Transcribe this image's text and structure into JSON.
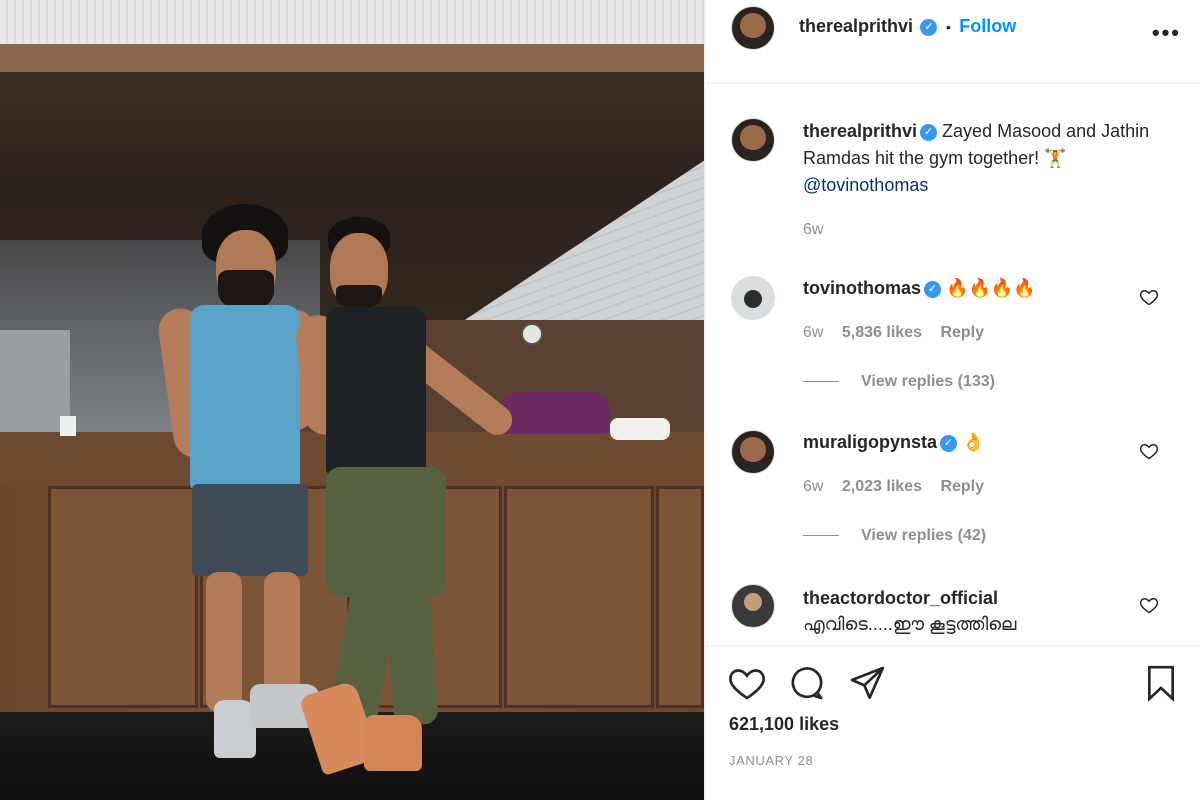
{
  "header": {
    "username": "therealprithvi",
    "separator": "•",
    "follow_label": "Follow",
    "more_icon": "more-options-icon"
  },
  "caption": {
    "username": "therealprithvi",
    "text": "Zayed Masood and Jathin Ramdas hit the gym together! 🏋",
    "mention": "@tovinothomas",
    "age": "6w"
  },
  "comments": [
    {
      "username": "tovinothomas",
      "verified": true,
      "text": "🔥🔥🔥🔥",
      "age": "6w",
      "likes": "5,836 likes",
      "reply_label": "Reply",
      "view_replies": "View replies (133)"
    },
    {
      "username": "muraligopynsta",
      "verified": true,
      "text": "👌",
      "age": "6w",
      "likes": "2,023 likes",
      "reply_label": "Reply",
      "view_replies": "View replies (42)"
    },
    {
      "username": "theactordoctor_official",
      "verified": false,
      "text": "എവിടെ.....ഈ കൂട്ടത്തിലെ"
    }
  ],
  "actions": {
    "icons": [
      "heart-icon",
      "comment-icon",
      "share-icon",
      "bookmark-icon"
    ],
    "likes": "621,100 likes",
    "date": "JANUARY 28"
  },
  "colors": {
    "link_blue": "#0095f6",
    "verified_blue": "#3897f0",
    "muted_text": "#8e8e8e",
    "text": "#262626"
  }
}
